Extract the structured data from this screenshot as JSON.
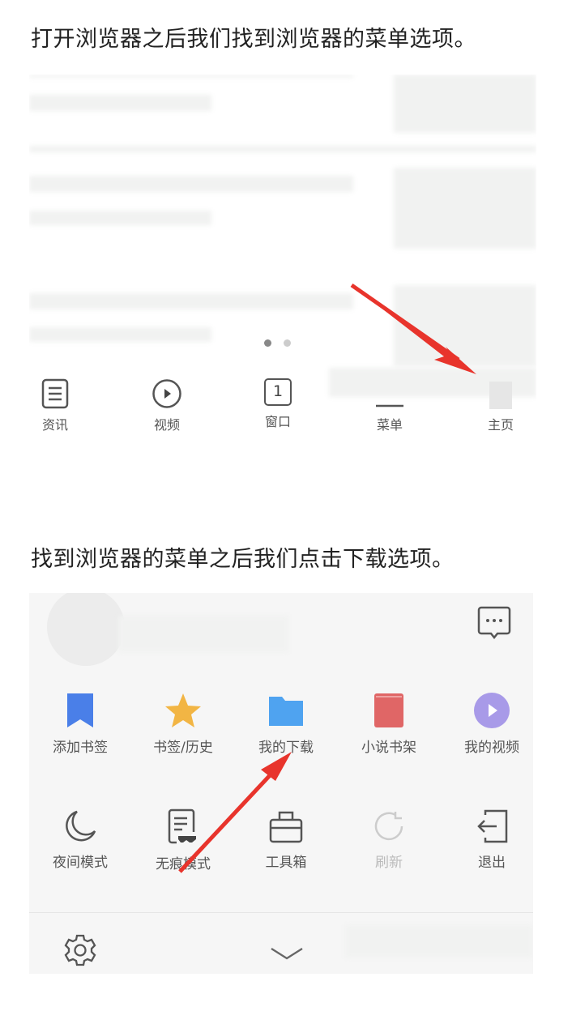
{
  "captions": [
    "打开浏览器之后我们找到浏览器的菜单选项。",
    "找到浏览器的菜单之后我们点击下载选项。"
  ],
  "shot1": {
    "tabs": [
      {
        "label": "资讯",
        "icon": "news-icon"
      },
      {
        "label": "视频",
        "icon": "play-circle-icon"
      },
      {
        "label": "窗口",
        "icon": "window-count-icon",
        "count": "1"
      },
      {
        "label": "菜单",
        "icon": "menu-icon"
      },
      {
        "label": "主页",
        "icon": "home-icon"
      }
    ]
  },
  "shot2": {
    "row1": [
      {
        "label": "添加书签",
        "icon": "bookmark-icon",
        "color": "#4a7fe8"
      },
      {
        "label": "书签/历史",
        "icon": "star-icon",
        "color": "#f2b544"
      },
      {
        "label": "我的下载",
        "icon": "folder-icon",
        "color": "#4fa3f0"
      },
      {
        "label": "小说书架",
        "icon": "book-icon",
        "color": "#e06666"
      },
      {
        "label": "我的视频",
        "icon": "video-icon",
        "color": "#a89ae8"
      }
    ],
    "row2": [
      {
        "label": "夜间模式",
        "icon": "moon-icon"
      },
      {
        "label": "无痕模式",
        "icon": "incognito-icon"
      },
      {
        "label": "工具箱",
        "icon": "toolbox-icon"
      },
      {
        "label": "刷新",
        "icon": "refresh-icon"
      },
      {
        "label": "退出",
        "icon": "exit-icon"
      }
    ]
  },
  "colors": {
    "arrow": "#e8342c"
  }
}
